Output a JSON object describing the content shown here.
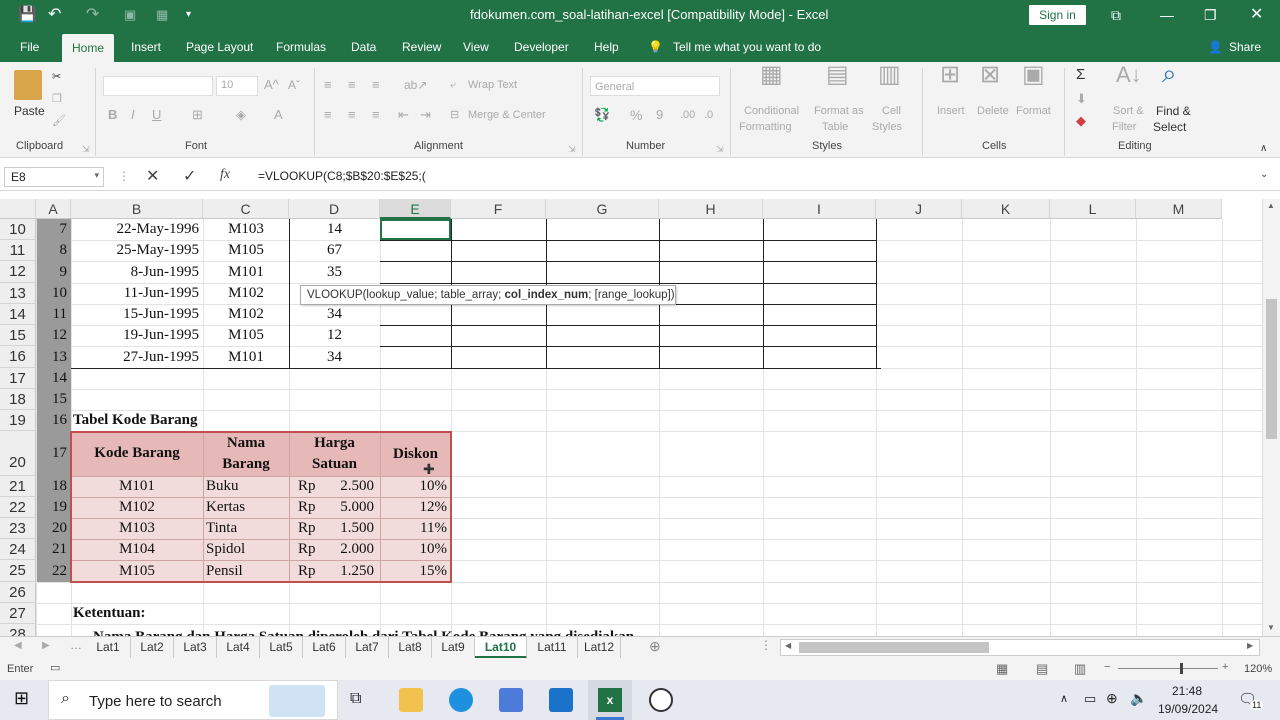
{
  "titlebar": {
    "title": "fdokumen.com_soal-latihan-excel  [Compatibility Mode]  -  Excel",
    "signin": "Sign in"
  },
  "tabs": {
    "file": "File",
    "home": "Home",
    "insert": "Insert",
    "page_layout": "Page Layout",
    "formulas": "Formulas",
    "data": "Data",
    "review": "Review",
    "view": "View",
    "developer": "Developer",
    "help": "Help",
    "tellme": "Tell me what you want to do",
    "share": "Share"
  },
  "ribbon": {
    "paste": "Paste",
    "clipboard": "Clipboard",
    "font_size": "10",
    "font_label": "Font",
    "wrap_text": "Wrap Text",
    "merge_center": "Merge & Center",
    "alignment": "Alignment",
    "number_format": "General",
    "number": "Number",
    "conditional": "Conditional",
    "formatting": "Formatting",
    "format_as": "Format as",
    "table": "Table",
    "cell": "Cell",
    "styles_word": "Styles",
    "styles": "Styles",
    "insert": "Insert",
    "delete": "Delete",
    "format": "Format",
    "cells": "Cells",
    "sort": "Sort &",
    "filter": "Filter",
    "find": "Find &",
    "select": "Select",
    "editing": "Editing"
  },
  "formula_bar": {
    "name_box": "E8",
    "fx": "fx",
    "formula": "=VLOOKUP(C8;$B$20:$E$25;("
  },
  "columns": [
    "A",
    "B",
    "C",
    "D",
    "E",
    "F",
    "G",
    "H",
    "I",
    "J",
    "K",
    "L",
    "M"
  ],
  "top_rows": [
    {
      "row": "10",
      "a": "7",
      "b": "22-May-1996",
      "c": "M103",
      "d": "14"
    },
    {
      "row": "11",
      "a": "8",
      "b": "25-May-1995",
      "c": "M105",
      "d": "67"
    },
    {
      "row": "12",
      "a": "9",
      "b": "8-Jun-1995",
      "c": "M101",
      "d": "35"
    },
    {
      "row": "13",
      "a": "10",
      "b": "11-Jun-1995",
      "c": "M102",
      "d": ""
    },
    {
      "row": "14",
      "a": "11",
      "b": "15-Jun-1995",
      "c": "M102",
      "d": "34"
    },
    {
      "row": "15",
      "a": "12",
      "b": "19-Jun-1995",
      "c": "M105",
      "d": "12"
    },
    {
      "row": "16",
      "a": "13",
      "b": "27-Jun-1995",
      "c": "M101",
      "d": "34"
    }
  ],
  "mid_rows": [
    {
      "row": "17",
      "a": "14"
    },
    {
      "row": "18",
      "a": "15"
    },
    {
      "row": "19",
      "a": "16"
    }
  ],
  "table_title": "Tabel Kode Barang",
  "kode_table": {
    "row_num": "20",
    "a_num": "17",
    "headers": {
      "kode": "Kode Barang",
      "nama1": "Nama",
      "nama2": "Barang",
      "harga1": "Harga",
      "harga2": "Satuan",
      "diskon": "Diskon"
    },
    "rows": [
      {
        "row": "21",
        "a": "18",
        "kode": "M101",
        "nama": "Buku",
        "rp": "Rp",
        "harga": "2.500",
        "diskon": "10%"
      },
      {
        "row": "22",
        "a": "19",
        "kode": "M102",
        "nama": "Kertas",
        "rp": "Rp",
        "harga": "5.000",
        "diskon": "12%"
      },
      {
        "row": "23",
        "a": "20",
        "kode": "M103",
        "nama": "Tinta",
        "rp": "Rp",
        "harga": "1.500",
        "diskon": "11%"
      },
      {
        "row": "24",
        "a": "21",
        "kode": "M104",
        "nama": "Spidol",
        "rp": "Rp",
        "harga": "2.000",
        "diskon": "10%"
      },
      {
        "row": "25",
        "a": "22",
        "kode": "M105",
        "nama": "Pensil",
        "rp": "Rp",
        "harga": "1.250",
        "diskon": "15%"
      }
    ]
  },
  "bottom_rows": [
    {
      "row": "26"
    },
    {
      "row": "27"
    },
    {
      "row": "28"
    }
  ],
  "ketentuan": "Ketentuan:",
  "ketentuan_line": "Nama Barang dan Harga Satuan diperoleh dari Tabel Kode Barang yang disediakan",
  "tooltip": {
    "pre": "VLOOKUP(lookup_value; table_array; ",
    "bold": "col_index_num",
    "post": "; [range_lookup])"
  },
  "sheet_tabs": [
    "Lat1",
    "Lat2",
    "Lat3",
    "Lat4",
    "Lat5",
    "Lat6",
    "Lat7",
    "Lat8",
    "Lat9",
    "Lat10",
    "Lat11",
    "Lat12"
  ],
  "active_sheet": "Lat10",
  "status": {
    "mode": "Enter",
    "zoom": "120%"
  },
  "taskbar": {
    "search": "Type here to search",
    "time": "21:48",
    "date": "19/09/2024",
    "notif": "11"
  },
  "colors": {
    "excel_green": "#217346",
    "table_fill": "#f2dcdb",
    "table_header_fill": "#e6b8b7",
    "table_border": "#c0504d"
  }
}
